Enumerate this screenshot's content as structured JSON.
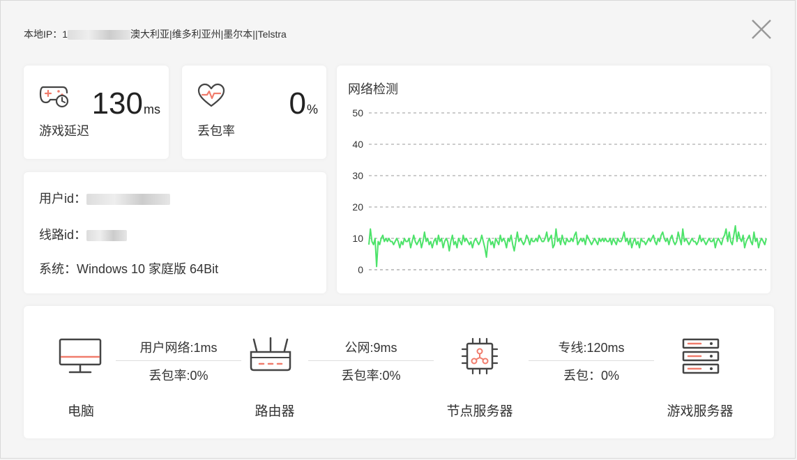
{
  "header": {
    "ip_label": "本地IP：",
    "ip_visible_prefix": "1",
    "location": "澳大利亚|维多利亚州|墨尔本||Telstra"
  },
  "latency": {
    "label": "游戏延迟",
    "value": "130",
    "unit": "ms"
  },
  "packet_loss": {
    "label": "丢包率",
    "value": "0",
    "unit": "%"
  },
  "info": {
    "user_id_label": "用户id：",
    "line_id_label": "线路id：",
    "system_label": "系统：",
    "system_value": "Windows 10 家庭版 64Bit"
  },
  "chart_title": "网络检测",
  "chart_data": {
    "type": "line",
    "title": "网络检测",
    "ylim": [
      0,
      50
    ],
    "yticks": [
      "0",
      "10",
      "20",
      "30",
      "40",
      "50"
    ],
    "grid": true,
    "series": [
      {
        "color": "#4de36a",
        "values": [
          8,
          13,
          9,
          8,
          10,
          1,
          9,
          8,
          10,
          11,
          9,
          10,
          9,
          10,
          9,
          9,
          8,
          9,
          10,
          9,
          7,
          9,
          8,
          10,
          9,
          9,
          10,
          7,
          9,
          11,
          9,
          8,
          9,
          10,
          7,
          9,
          12,
          9,
          10,
          8,
          9,
          7,
          9,
          10,
          8,
          11,
          9,
          10,
          7,
          9,
          10,
          9,
          6,
          9,
          11,
          8,
          9,
          7,
          10,
          9,
          8,
          11,
          9,
          10,
          9,
          8,
          9,
          7,
          9,
          10,
          9,
          8,
          9,
          11,
          9,
          7,
          4,
          9,
          10,
          8,
          9,
          7,
          10,
          9,
          8,
          11,
          9,
          10,
          9,
          7,
          10,
          9,
          11,
          8,
          6,
          9,
          12,
          9,
          10,
          9,
          8,
          9,
          11,
          10,
          8,
          10,
          9,
          9,
          10,
          9,
          11,
          10,
          9,
          9,
          10,
          12,
          9,
          10,
          11,
          7,
          8,
          13,
          9,
          10,
          8,
          11,
          9,
          8,
          10,
          9,
          9,
          10,
          9,
          11,
          12,
          8,
          9,
          10,
          9,
          10,
          8,
          11,
          10,
          9,
          8,
          9,
          10,
          9,
          8,
          10,
          9,
          10,
          9,
          10,
          9,
          9,
          10,
          8,
          10,
          9,
          8,
          10,
          9,
          9,
          10,
          12,
          9,
          10,
          8,
          10,
          7,
          9,
          10,
          8,
          9,
          7,
          10,
          9,
          9,
          8,
          9,
          10,
          9,
          10,
          11,
          9,
          8,
          10,
          9,
          11,
          12,
          10,
          9,
          10,
          8,
          10,
          11,
          9,
          8,
          9,
          12,
          10,
          8,
          13,
          9,
          10,
          9,
          8,
          9,
          10,
          9,
          9,
          8,
          9,
          11,
          9,
          10,
          9,
          8,
          9,
          10,
          9,
          9,
          10,
          7,
          9,
          10,
          9,
          8,
          10,
          11,
          13,
          9,
          12,
          9,
          8,
          11,
          14,
          9,
          12,
          10,
          9,
          11,
          7,
          9,
          10,
          11,
          9,
          8,
          12,
          9,
          10,
          7,
          9,
          10,
          9,
          8,
          10
        ]
      }
    ]
  },
  "route": {
    "nodes": [
      {
        "label": "电脑",
        "icon": "computer-icon"
      },
      {
        "label": "路由器",
        "icon": "router-icon"
      },
      {
        "label": "节点服务器",
        "icon": "chip-icon"
      },
      {
        "label": "游戏服务器",
        "icon": "server-icon"
      }
    ],
    "links": [
      {
        "top": "用户网络:1ms",
        "bottom": "丢包率:0%"
      },
      {
        "top": "公网:9ms",
        "bottom": "丢包率:0%"
      },
      {
        "top": "专线:120ms",
        "bottom": "丢包：0%"
      }
    ]
  },
  "colors": {
    "accent": "#f07c6c",
    "line": "#4de36a",
    "icon_dark": "#444444"
  }
}
